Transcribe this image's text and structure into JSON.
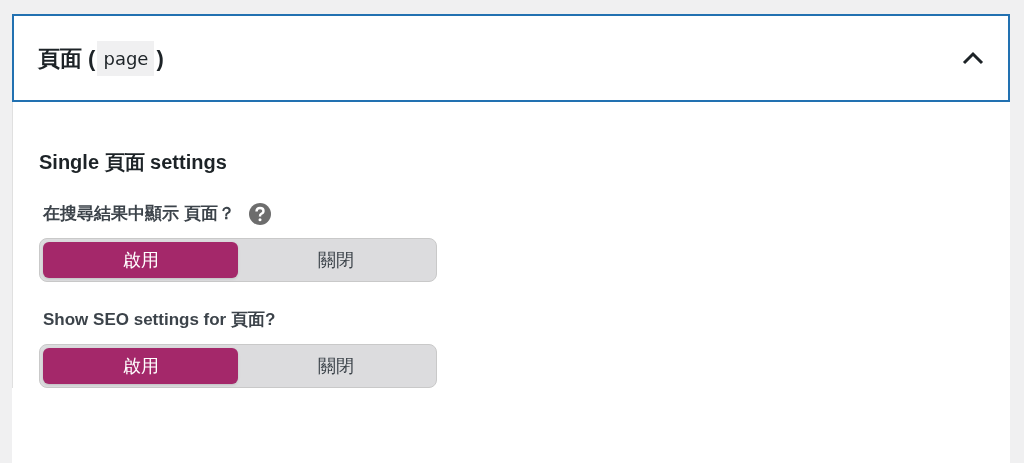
{
  "panel": {
    "title": "頁面 (",
    "code": "page",
    "title_end": ")",
    "expanded": true
  },
  "section": {
    "heading": "Single 頁面 settings",
    "settings": [
      {
        "label": "在搜尋結果中顯示 頁面？",
        "help": true,
        "options": [
          {
            "label": "啟用",
            "selected": true
          },
          {
            "label": "關閉",
            "selected": false
          }
        ]
      },
      {
        "label": "Show SEO settings for 頁面?",
        "help": false,
        "options": [
          {
            "label": "啟用",
            "selected": true
          },
          {
            "label": "關閉",
            "selected": false
          }
        ]
      }
    ]
  }
}
